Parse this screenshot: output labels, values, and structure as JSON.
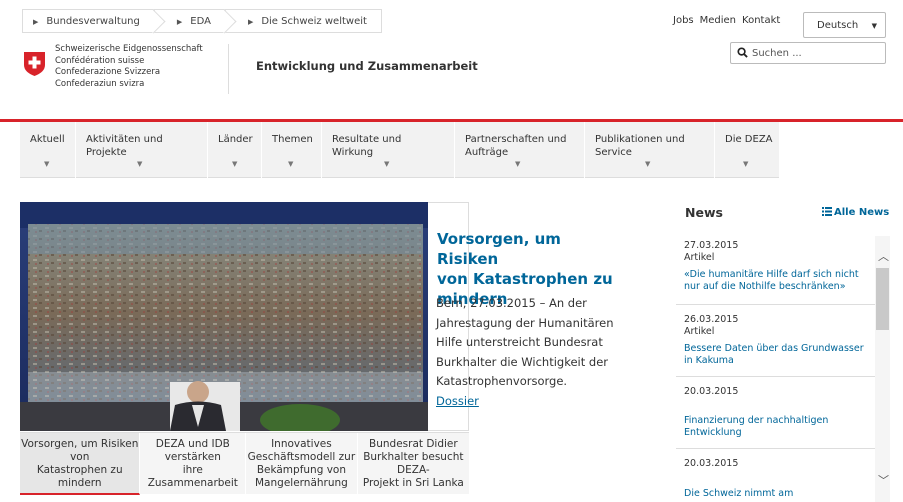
{
  "breadcrumbs": [
    "Bundesverwaltung",
    "EDA",
    "Die Schweiz weltweit"
  ],
  "top_links": [
    "Jobs",
    "Medien",
    "Kontakt"
  ],
  "language": "Deutsch",
  "search_placeholder": "Suchen ...",
  "confederation": [
    "Schweizerische Eidgenossenschaft",
    "Confédération suisse",
    "Confederazione Svizzera",
    "Confederaziun svizra"
  ],
  "unit_name": "Entwicklung und Zusammenarbeit",
  "nav": [
    {
      "l1": "Aktuell",
      "l2": ""
    },
    {
      "l1": "Aktivitäten und",
      "l2": "Projekte"
    },
    {
      "l1": "Länder",
      "l2": ""
    },
    {
      "l1": "Themen",
      "l2": ""
    },
    {
      "l1": "Resultate und",
      "l2": "Wirkung"
    },
    {
      "l1": "Partnerschaften und",
      "l2": "Aufträge"
    },
    {
      "l1": "Publikationen und",
      "l2": "Service"
    },
    {
      "l1": "Die DEZA",
      "l2": ""
    }
  ],
  "hero": {
    "title_lines": [
      "Vorsorgen, um Risiken",
      "von Katastrophen zu",
      "mindern"
    ],
    "text_lines": [
      "Bern, 27.03.2015 – An der",
      "Jahrestagung der Humanitären",
      "Hilfe unterstreicht Bundesrat",
      "Burkhalter die Wichtigkeit der",
      "Katastrophenvorsorge."
    ],
    "link": "Dossier"
  },
  "tabs": [
    [
      "Vorsorgen, um Risiken von",
      "Katastrophen zu mindern"
    ],
    [
      "DEZA und IDB verstärken",
      "ihre Zusammenarbeit"
    ],
    [
      "Innovatives",
      "Geschäftsmodell zur",
      "Bekämpfung von",
      "Mangelernährung"
    ],
    [
      "Bundesrat Didier",
      "Burkhalter besucht DEZA-",
      "Projekt in Sri Lanka"
    ]
  ],
  "news": {
    "heading": "News",
    "all_link": "Alle News",
    "items": [
      {
        "date": "27.03.2015",
        "type": "Artikel",
        "title": [
          "«Die humanitäre Hilfe darf sich nicht",
          "nur auf die Nothilfe beschränken»"
        ]
      },
      {
        "date": "26.03.2015",
        "type": "Artikel",
        "title": [
          "Bessere Daten über das Grundwasser",
          "in Kakuma"
        ]
      },
      {
        "date": "20.03.2015",
        "type": "",
        "title": [
          "Finanzierung der nachhaltigen",
          "Entwicklung"
        ]
      },
      {
        "date": "20.03.2015",
        "type": "",
        "title": [
          "Die Schweiz nimmt am"
        ]
      }
    ]
  },
  "colors": {
    "accent_red": "#d8232a",
    "link_blue": "#006699"
  }
}
